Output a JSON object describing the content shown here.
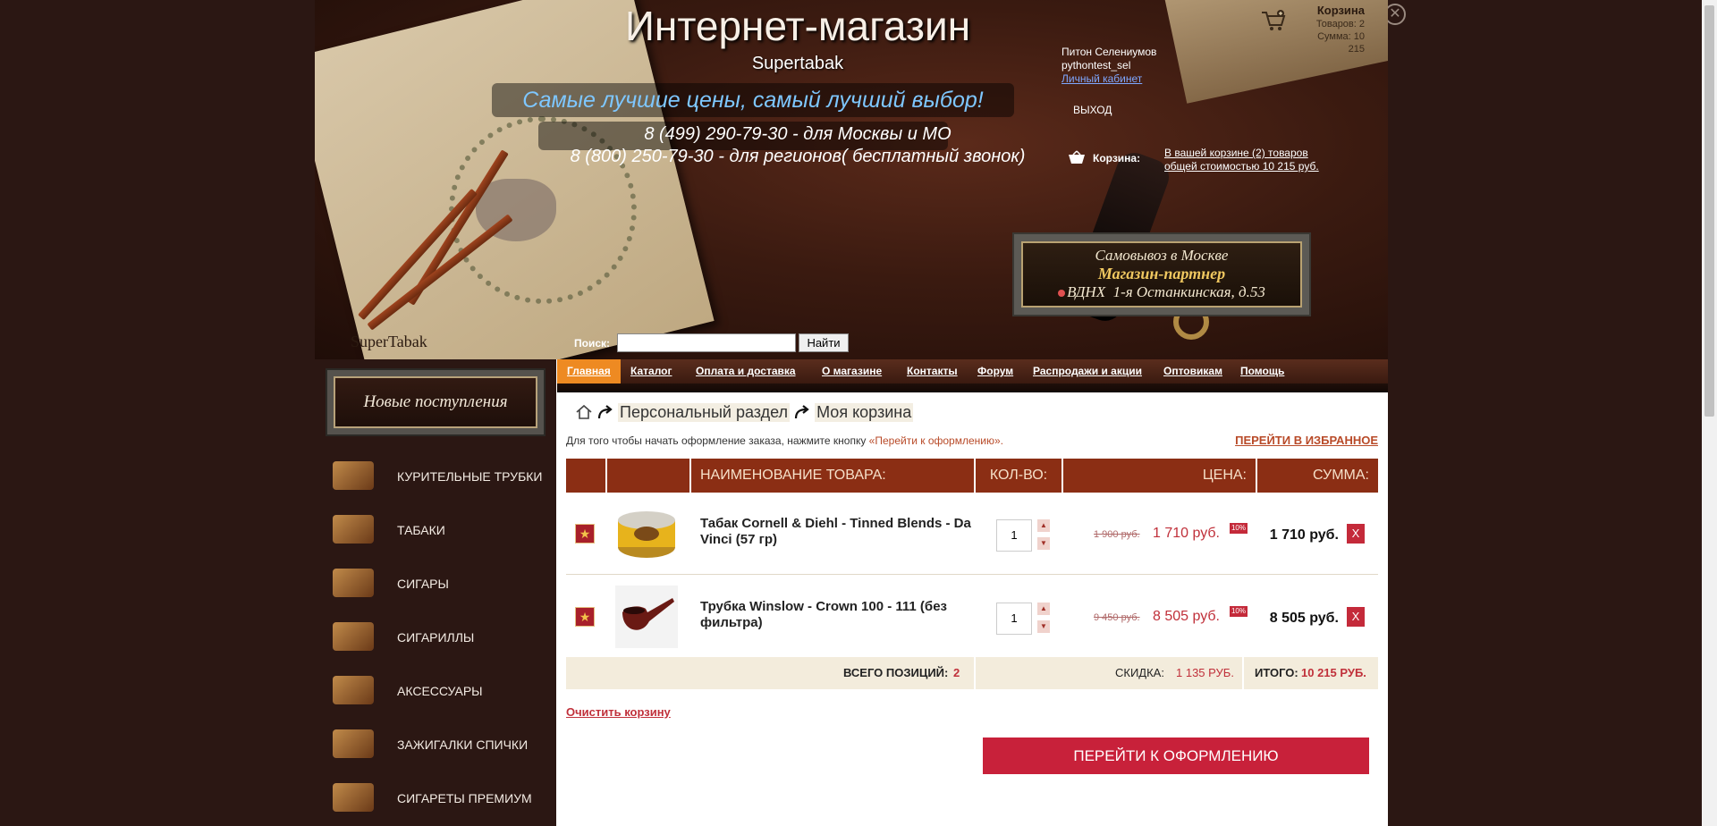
{
  "header": {
    "title": "Интернет-магазин",
    "subtitle": "Supertabak",
    "slogan": "Самые лучшие цены, самый лучший выбор!",
    "phone_moscow": "8 (499) 290-79-30 - для Москвы и МО",
    "phone_regions": "8 (800) 250-79-30 - для регионов( бесплатный звонок)",
    "brand": "SuperTabak",
    "search_label": "Поиск:",
    "search_value": "",
    "search_button": "Найти"
  },
  "user": {
    "name": "Питон Селениумов",
    "login": "pythontest_sel",
    "cabinet_link": "Личный кабинет",
    "logout": "ВЫХОД"
  },
  "mini_cart": {
    "title": "Корзина",
    "items_line": "Товаров: 2",
    "sum_line": "Сумма: 10",
    "sum_line2": "215"
  },
  "cart_info": {
    "label": "Корзина:",
    "text_line1": "В вашей корзине (2) товаров",
    "text_line2": "общей стоимостью 10 215 руб."
  },
  "partner": {
    "line1": "Самовывоз  в  Москве",
    "line2": "Магазин-партнер",
    "line3_station": "ВДНХ",
    "line3_address": "1-я Останкинская, д.53"
  },
  "sidebar": {
    "new_arrivals": "Новые поступления",
    "categories": [
      {
        "label": "КУРИТЕЛЬНЫЕ ТРУБКИ"
      },
      {
        "label": "ТАБАКИ"
      },
      {
        "label": "СИГАРЫ"
      },
      {
        "label": "СИГАРИЛЛЫ"
      },
      {
        "label": "АКСЕССУАРЫ"
      },
      {
        "label": "ЗАЖИГАЛКИ СПИЧКИ"
      },
      {
        "label": "СИГАРЕТЫ ПРЕМИУМ"
      }
    ]
  },
  "nav": {
    "items": [
      {
        "label": "Главная",
        "active": true
      },
      {
        "label": "Каталог"
      },
      {
        "label": "Оплата и доставка"
      },
      {
        "label": "О магазине"
      },
      {
        "label": "Контакты"
      },
      {
        "label": "Форум"
      },
      {
        "label": "Распродажи и акции"
      },
      {
        "label": "Оптовикам"
      },
      {
        "label": "Помощь"
      }
    ]
  },
  "breadcrumb": {
    "items": [
      "Персональный раздел",
      "Моя корзина"
    ]
  },
  "cart": {
    "instruction_prefix": "Для того чтобы начать оформление заказа, нажмите кнопку ",
    "instruction_button": "«Перейти к оформлению».",
    "to_favorites": "ПЕРЕЙТИ В ИЗБРАННОЕ",
    "columns": {
      "name": "НАИМЕНОВАНИЕ ТОВАРА:",
      "qty": "КОЛ-ВО:",
      "price": "ЦЕНА:",
      "sum": "СУММА:"
    },
    "rows": [
      {
        "name": "Табак Cornell & Diehl - Tinned Blends - Da Vinci (57 гр)",
        "qty": "1",
        "old_price": "1 900 руб.",
        "price": "1 710 руб.",
        "discount": "10%",
        "sum": "1 710 руб.",
        "delete": "X",
        "flag": "★",
        "up": "▲",
        "down": "▼"
      },
      {
        "name": "Трубка Winslow - Crown 100 - 111 (без фильтра)",
        "qty": "1",
        "old_price": "9 450 руб.",
        "price": "8 505 руб.",
        "discount": "10%",
        "sum": "8 505 руб.",
        "delete": "X",
        "flag": "★",
        "up": "▲",
        "down": "▼"
      }
    ],
    "total_positions_label": "ВСЕГО ПОЗИЦИЙ:",
    "total_positions": "2",
    "discount_label": "СКИДКА:",
    "discount_value": "1 135 РУБ.",
    "total_label": "ИТОГО:",
    "total_value": "10 215 РУБ.",
    "clear_cart": "Очистить корзину",
    "checkout": "ПЕРЕЙТИ К ОФОРМЛЕНИЮ"
  },
  "close_glyph": "✕"
}
